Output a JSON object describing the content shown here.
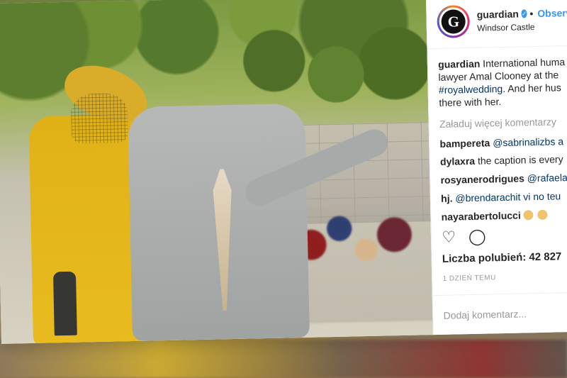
{
  "profile": {
    "username": "guardian",
    "follow_label": "Obserw",
    "location": "Windsor Castle",
    "avatar_letter": "G"
  },
  "post": {
    "caption_username": "guardian",
    "caption_text_1": "International huma",
    "caption_text_2": "lawyer Amal Clooney at the",
    "caption_tag": "#royalwedding",
    "caption_text_3": ". And her hus",
    "caption_text_4": "there with her.",
    "load_more": "Załaduj więcej komentarzy",
    "comments": [
      {
        "user": "bampereta",
        "text": "@sabrinalizbs a"
      },
      {
        "user": "dylaxra",
        "text": "the caption is every"
      },
      {
        "user": "rosyanerodrigues",
        "text": "@rafaela"
      },
      {
        "user": "hj.",
        "text": "@brendarachit vi no teu"
      },
      {
        "user": "nayarabertolucci",
        "text": ""
      }
    ],
    "likes": "Liczba polubień: 42 827",
    "time": "1 DZIEŃ TEMU",
    "comment_placeholder": "Dodaj komentarz..."
  },
  "icons": {
    "heart": "♡",
    "comment": "◯"
  },
  "colors": {
    "accent": "#3897f0",
    "text": "#262626",
    "muted": "#999999"
  }
}
